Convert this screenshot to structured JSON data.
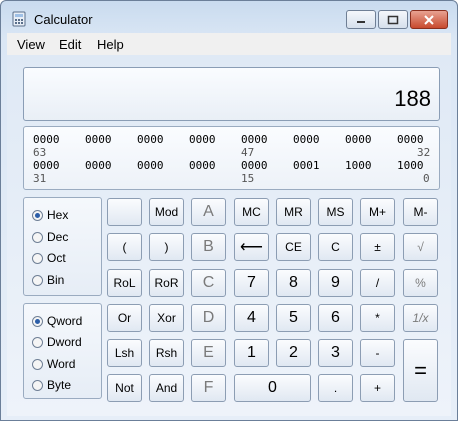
{
  "window": {
    "title": "Calculator"
  },
  "menu": {
    "items": [
      "View",
      "Edit",
      "Help"
    ]
  },
  "display": {
    "value": "188"
  },
  "bits": {
    "row1": [
      "0000",
      "0000",
      "0000",
      "0000",
      "0000",
      "0000",
      "0000",
      "0000"
    ],
    "pos1": [
      "63",
      "47",
      "32"
    ],
    "row2": [
      "0000",
      "0000",
      "0000",
      "0000",
      "0000",
      "0001",
      "1000",
      "1000"
    ],
    "pos2": [
      "31",
      "15",
      "0"
    ]
  },
  "base": {
    "options": [
      "Hex",
      "Dec",
      "Oct",
      "Bin"
    ],
    "selected": "Hex"
  },
  "word": {
    "options": [
      "Qword",
      "Dword",
      "Word",
      "Byte"
    ],
    "selected": "Qword"
  },
  "keys": {
    "blank": "",
    "mod": "Mod",
    "A": "A",
    "MC": "MC",
    "MR": "MR",
    "MS": "MS",
    "Mplus": "M+",
    "Mminus": "M-",
    "lparen": "(",
    "rparen": ")",
    "B": "B",
    "back": "⟵",
    "CE": "CE",
    "C": "C",
    "pm": "±",
    "sqrt": "√",
    "RoL": "RoL",
    "RoR": "RoR",
    "Ckey": "C",
    "n7": "7",
    "n8": "8",
    "n9": "9",
    "div": "/",
    "pct": "%",
    "Or": "Or",
    "Xor": "Xor",
    "D": "D",
    "n4": "4",
    "n5": "5",
    "n6": "6",
    "mul": "*",
    "recip": "1/x",
    "Lsh": "Lsh",
    "Rsh": "Rsh",
    "E": "E",
    "n1": "1",
    "n2": "2",
    "n3": "3",
    "minus": "-",
    "Not": "Not",
    "And": "And",
    "F": "F",
    "n0": "0",
    "dot": ".",
    "plus": "+",
    "eq": "="
  }
}
